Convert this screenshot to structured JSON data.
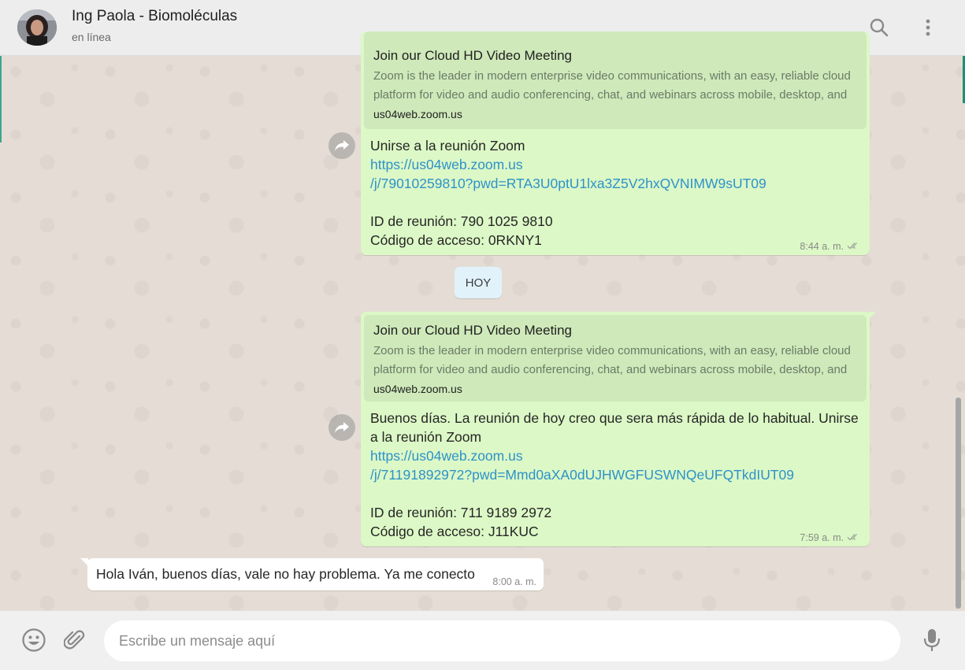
{
  "header": {
    "contact_name": "Ing Paola - Biomoléculas",
    "status": "en línea",
    "icons": [
      "search-icon",
      "menu-icon"
    ]
  },
  "messages": {
    "first": {
      "preview_title": "Join our Cloud HD Video Meeting",
      "preview_desc_line1": "Zoom is the leader in modern enterprise video communications, with an easy, reliable cloud",
      "preview_desc_line2": "platform for video and audio conferencing, chat, and webinars across mobile, desktop, and",
      "preview_domain": "us04web.zoom.us",
      "text_line1": "Unirse a la reunión Zoom",
      "link_line1": "https://us04web.zoom.us",
      "link_line2": "/j/79010259810?pwd=RTA3U0ptU1lxa3Z5V2hxQVNIMW9sUT09",
      "id_line": "ID de reunión: 790 1025 9810",
      "code_line": "Código de acceso: 0RKNY1",
      "time": "8:44 a. m."
    },
    "date_divider": "HOY",
    "second": {
      "preview_title": "Join our Cloud HD Video Meeting",
      "preview_desc_line1": "Zoom is the leader in modern enterprise video communications, with an easy, reliable cloud",
      "preview_desc_line2": "platform for video and audio conferencing, chat, and webinars across mobile, desktop, and",
      "preview_domain": "us04web.zoom.us",
      "text_line1": "Buenos días. La reunión de hoy creo que sera más rápida de lo habitual. Unirse",
      "text_line2": "a la reunión Zoom",
      "link_line1": "https://us04web.zoom.us",
      "link_line2": "/j/71191892972?pwd=Mmd0aXA0dUJHWGFUSWNQeUFQTkdIUT09",
      "id_line": "ID de reunión: 711 9189 2972",
      "code_line": "Código de acceso: J11KUC",
      "time": "7:59 a. m."
    },
    "reply": {
      "text": "Hola Iván, buenos días, vale no hay problema. Ya me conecto",
      "time": "8:00 a. m."
    }
  },
  "composer": {
    "placeholder": "Escribe un mensaje aquí"
  },
  "colors": {
    "outgoing_bubble": "#dcf8c6",
    "incoming_bubble": "#ffffff",
    "link": "#2e92c9",
    "chat_background": "#e5ddd5"
  }
}
